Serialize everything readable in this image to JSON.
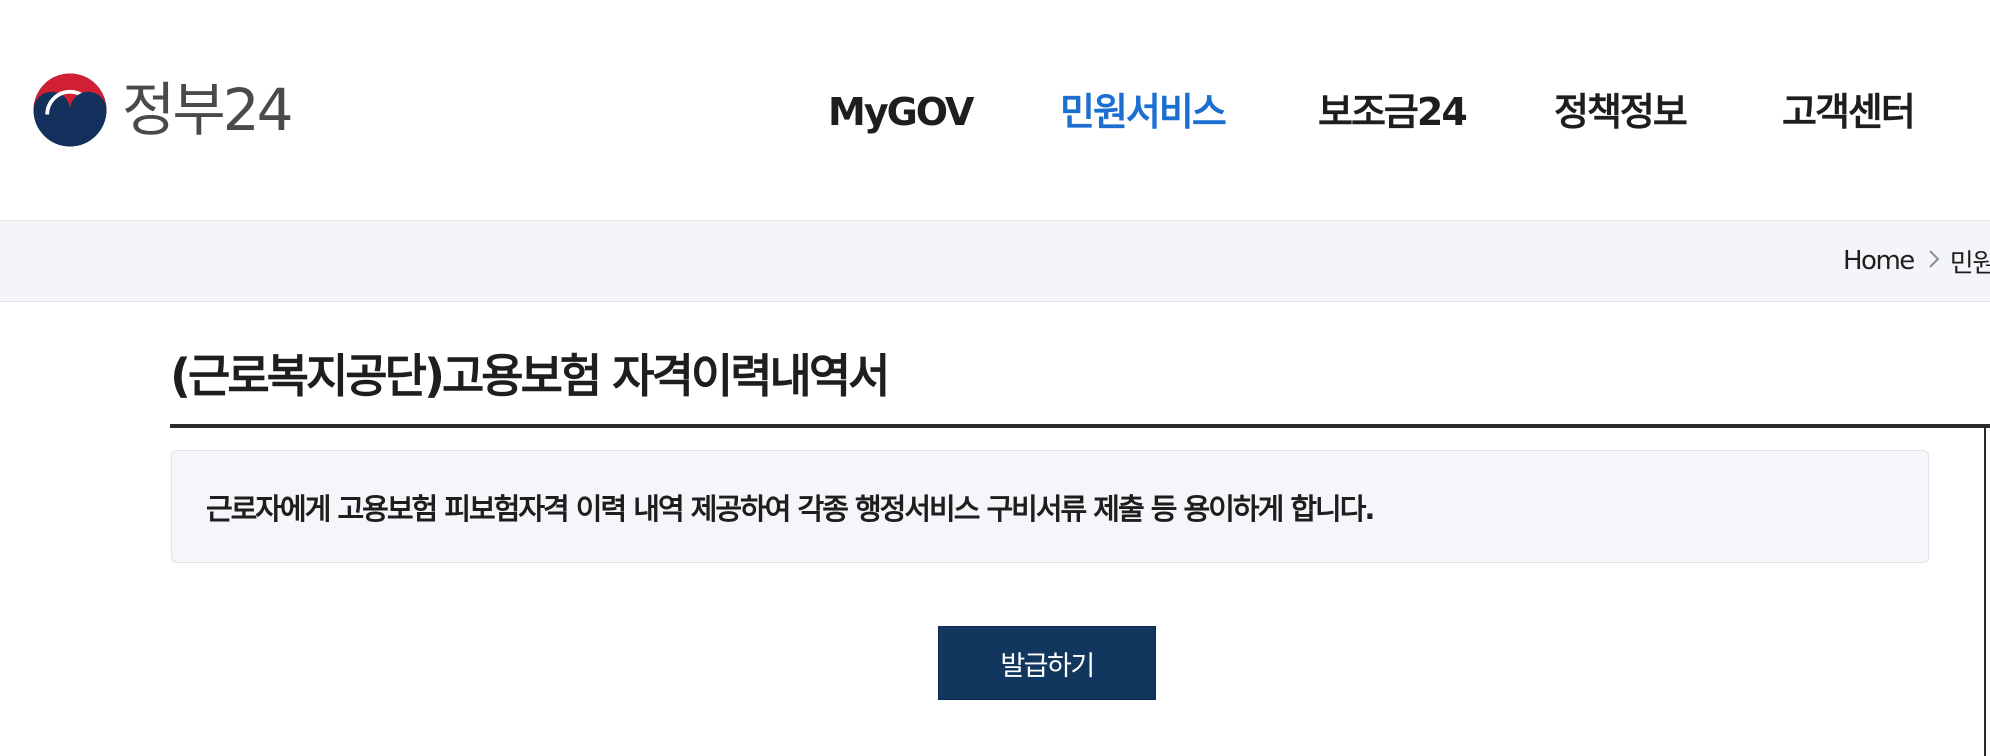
{
  "header": {
    "logo_text": "정부24",
    "nav": [
      {
        "label": "MyGOV"
      },
      {
        "label": "민원서비스"
      },
      {
        "label": "보조금24"
      },
      {
        "label": "정책정보"
      },
      {
        "label": "고객센터"
      }
    ]
  },
  "breadcrumb": {
    "items": [
      "Home",
      "민원서비스"
    ]
  },
  "main": {
    "title": "(근로복지공단)고용보험 자격이력내역서",
    "description": "근로자에게 고용보험 피보험자격 이력 내역 제공하여 각종 행정서비스 구비서류 제출 등 용이하게 합니다.",
    "issue_button": "발급하기"
  },
  "colors": {
    "active_nav": "#1a6fd0",
    "button_bg": "#12375f",
    "location_bar_bg": "#f4f5f8"
  },
  "icons": {
    "logo": "taegeuk-emblem-icon",
    "breadcrumb_separator": "chevron-right-icon"
  }
}
